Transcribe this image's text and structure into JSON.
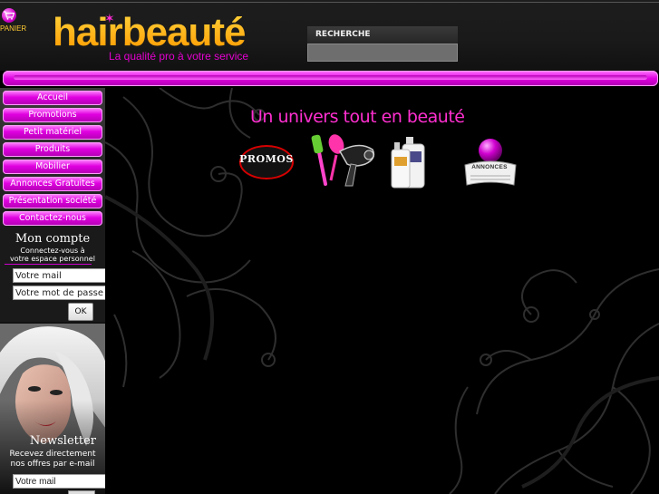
{
  "header": {
    "cart_label": "PANIER",
    "logo_text": "hairbeauté",
    "tagline": "La qualité pro à votre service",
    "search_label": "RECHERCHE",
    "search_value": ""
  },
  "sidebar": {
    "menu": [
      {
        "label": "Accueil"
      },
      {
        "label": "Promotions"
      },
      {
        "label": "Petit matériel"
      },
      {
        "label": "Produits"
      },
      {
        "label": "Mobilier"
      },
      {
        "label": "Annonces Gratuites"
      },
      {
        "label": "Présentation société"
      },
      {
        "label": "Contactez-nous"
      }
    ],
    "account": {
      "title": "Mon compte",
      "subtitle_line1": "Connectez-vous à",
      "subtitle_line2": "votre espace personnel",
      "email_placeholder": "Votre mail",
      "password_placeholder": "Votre mot de passe",
      "ok_label": "OK"
    },
    "newsletter": {
      "title": "Newsletter",
      "line1": "Recevez directement",
      "line2": "nos offres par e-mail",
      "email_placeholder": "Votre mail"
    }
  },
  "main": {
    "slogan": "Un univers tout en beauté",
    "categories": [
      {
        "icon": "promos-badge-icon",
        "label": "PROMOS"
      },
      {
        "icon": "hairdryer-brush-icon"
      },
      {
        "icon": "shampoo-bottles-icon"
      },
      {
        "icon": "newspaper-annonces-icon",
        "label": "ANNONCES"
      }
    ]
  },
  "colors": {
    "accent": "#e000e0",
    "slogan": "#ff2fd0",
    "logo": "#ffb000",
    "background": "#000000"
  }
}
